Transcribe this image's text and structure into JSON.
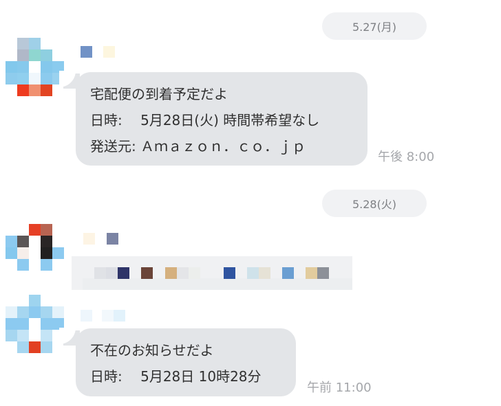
{
  "messages": [
    {
      "date": "5.27(月)",
      "time": "午後 8:00",
      "lines": [
        "宅配便の到着予定だよ",
        "日時:　 5月28日(火)  時間帯希望なし",
        "発送元: Ａｍａｚｏｎ．ｃｏ．ｊｐ"
      ]
    },
    {
      "date": "5.28(火)"
    },
    {
      "time": "午前 11:00",
      "lines": [
        "不在のお知らせだよ",
        "日時:　 5月28日 10時28分"
      ]
    }
  ],
  "colors": {
    "bubble": "#e3e5e8",
    "date_pill": "#f1f2f4",
    "timestamp": "#a5a7ab"
  }
}
